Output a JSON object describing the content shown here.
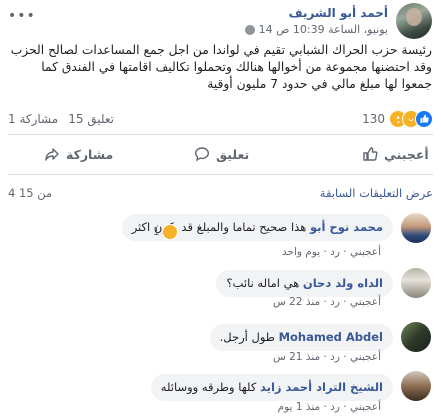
{
  "post": {
    "author": "أحمد أبو الشريف",
    "date": "14 يونيو، الساعة 10:39 ص",
    "dots": "•••",
    "text": "رئيسة حزب الحراك الشبابي تقيم في لواندا من اجل جمع المساعدات لصالح الحزب وقد احتضنها مجموعة من أخوالها هنالك وتحملوا تكاليف اقامتها في الفندق كما جمعوا لها مبلغ مالي في حدود 7 مليون أوقية"
  },
  "stats": {
    "reactions_count": "130",
    "comments": "15 تعليق",
    "shares": "1 مشاركة"
  },
  "actions": {
    "like": "أعجبني",
    "comment": "تعليق",
    "share": "مشاركة"
  },
  "comments_section": {
    "view_previous": "عرض التعليقات السابقة",
    "count": "4 من 15"
  },
  "comments": [
    {
      "name": "محمد نوح أبو",
      "text": "هذا صحيح تماما والمبلغ قد يكون اكثر",
      "like": "أعجبني",
      "reply": "رد",
      "time": "يوم واحد",
      "reactions": "1"
    },
    {
      "name": "الداه ولد دحان",
      "text": "هي اماله نائب؟",
      "like": "أعجبني",
      "reply": "رد",
      "time": "منذ 22 س"
    },
    {
      "name": "Mohamed Abdel",
      "text": "طول أرجل.",
      "like": "أعجبني",
      "reply": "رد",
      "time": "منذ 21 س"
    },
    {
      "name": "الشيخ التراد أحمد زايد",
      "text": "كلها وطرقه ووسائله",
      "like": "أعجبني",
      "reply": "رد",
      "time": "منذ 1 يوم"
    }
  ],
  "colors": {
    "link": "#385898",
    "muted": "#606770",
    "bubble": "#f2f3f5",
    "like_blue": "#1877f2",
    "emoji_yellow": "#f7b125"
  }
}
